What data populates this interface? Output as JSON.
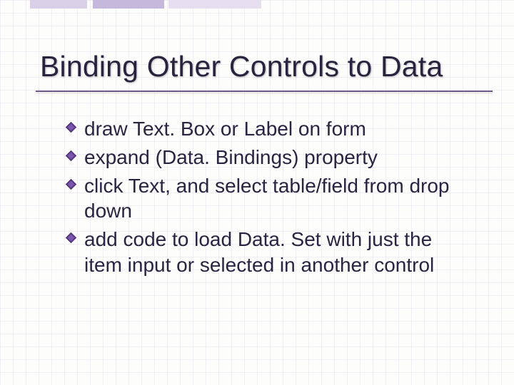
{
  "slide": {
    "title": "Binding Other Controls to Data",
    "bullets": [
      "draw Text. Box or Label on form",
      "expand (Data. Bindings) property",
      "click Text, and select table/field from drop down",
      "add code to load Data. Set with just the item input or selected in another control"
    ]
  },
  "colors": {
    "bullet_fill": "#5d3b8a",
    "bullet_edge": "#3c2560"
  }
}
